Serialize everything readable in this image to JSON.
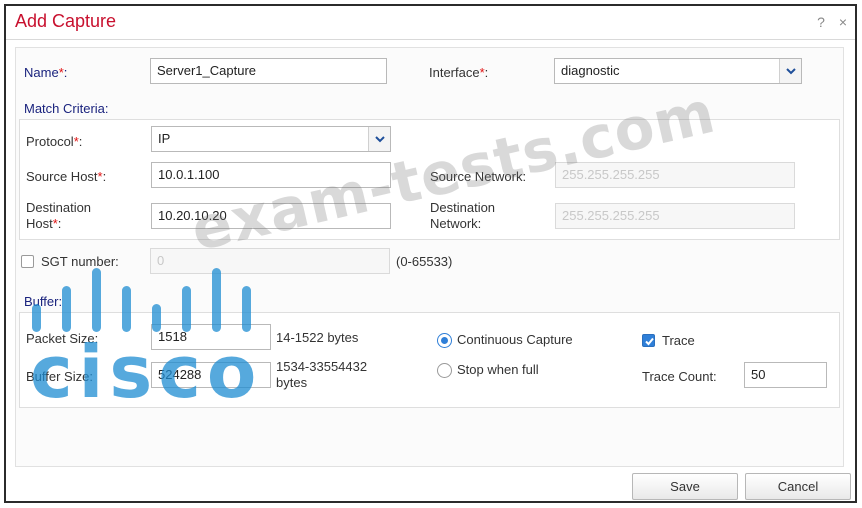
{
  "dialog": {
    "title": "Add Capture",
    "help_icon": "?",
    "close_icon": "×"
  },
  "form": {
    "name": {
      "label": "Name",
      "required": "*",
      "colon": ":",
      "value": "Server1_Capture"
    },
    "interface": {
      "label": "Interface",
      "required": "*",
      "colon": ":",
      "value": "diagnostic"
    },
    "match_criteria_label": "Match Criteria:",
    "protocol": {
      "label": "Protocol",
      "required": "*",
      "colon": ":",
      "value": "IP"
    },
    "source_host": {
      "label": "Source Host",
      "required": "*",
      "colon": ":",
      "value": "10.0.1.100"
    },
    "source_network": {
      "label": "Source Network:",
      "value": "255.255.255.255"
    },
    "destination_host": {
      "label_line1": "Destination",
      "label_line2": "Host",
      "required": "*",
      "colon": ":",
      "value": "10.20.10.20"
    },
    "destination_network": {
      "label_line1": "Destination",
      "label_line2": "Network:",
      "value": "255.255.255.255"
    },
    "sgt": {
      "label": "SGT number:",
      "value": "0",
      "range": "(0-65533)",
      "checked": false
    },
    "buffer_label": "Buffer:",
    "packet_size": {
      "label": "Packet Size:",
      "value": "1518",
      "range": "14-1522 bytes"
    },
    "buffer_size": {
      "label": "Buffer Size:",
      "value": "524288",
      "range_line1": "1534-33554432",
      "range_line2": "bytes"
    },
    "continuous_capture": {
      "label": "Continuous Capture",
      "selected": true
    },
    "stop_when_full": {
      "label": "Stop when full",
      "selected": false
    },
    "trace": {
      "label": "Trace",
      "checked": true
    },
    "trace_count": {
      "label": "Trace Count:",
      "value": "50"
    }
  },
  "footer": {
    "save_label": "Save",
    "cancel_label": "Cancel"
  },
  "watermark": {
    "text": "exam-tests.com",
    "logo_word": "cisco"
  },
  "colors": {
    "title_red": "#c8102e",
    "section_blue": "#1a237e",
    "required_red": "#e01010",
    "accent_blue": "#2f7fd8"
  }
}
